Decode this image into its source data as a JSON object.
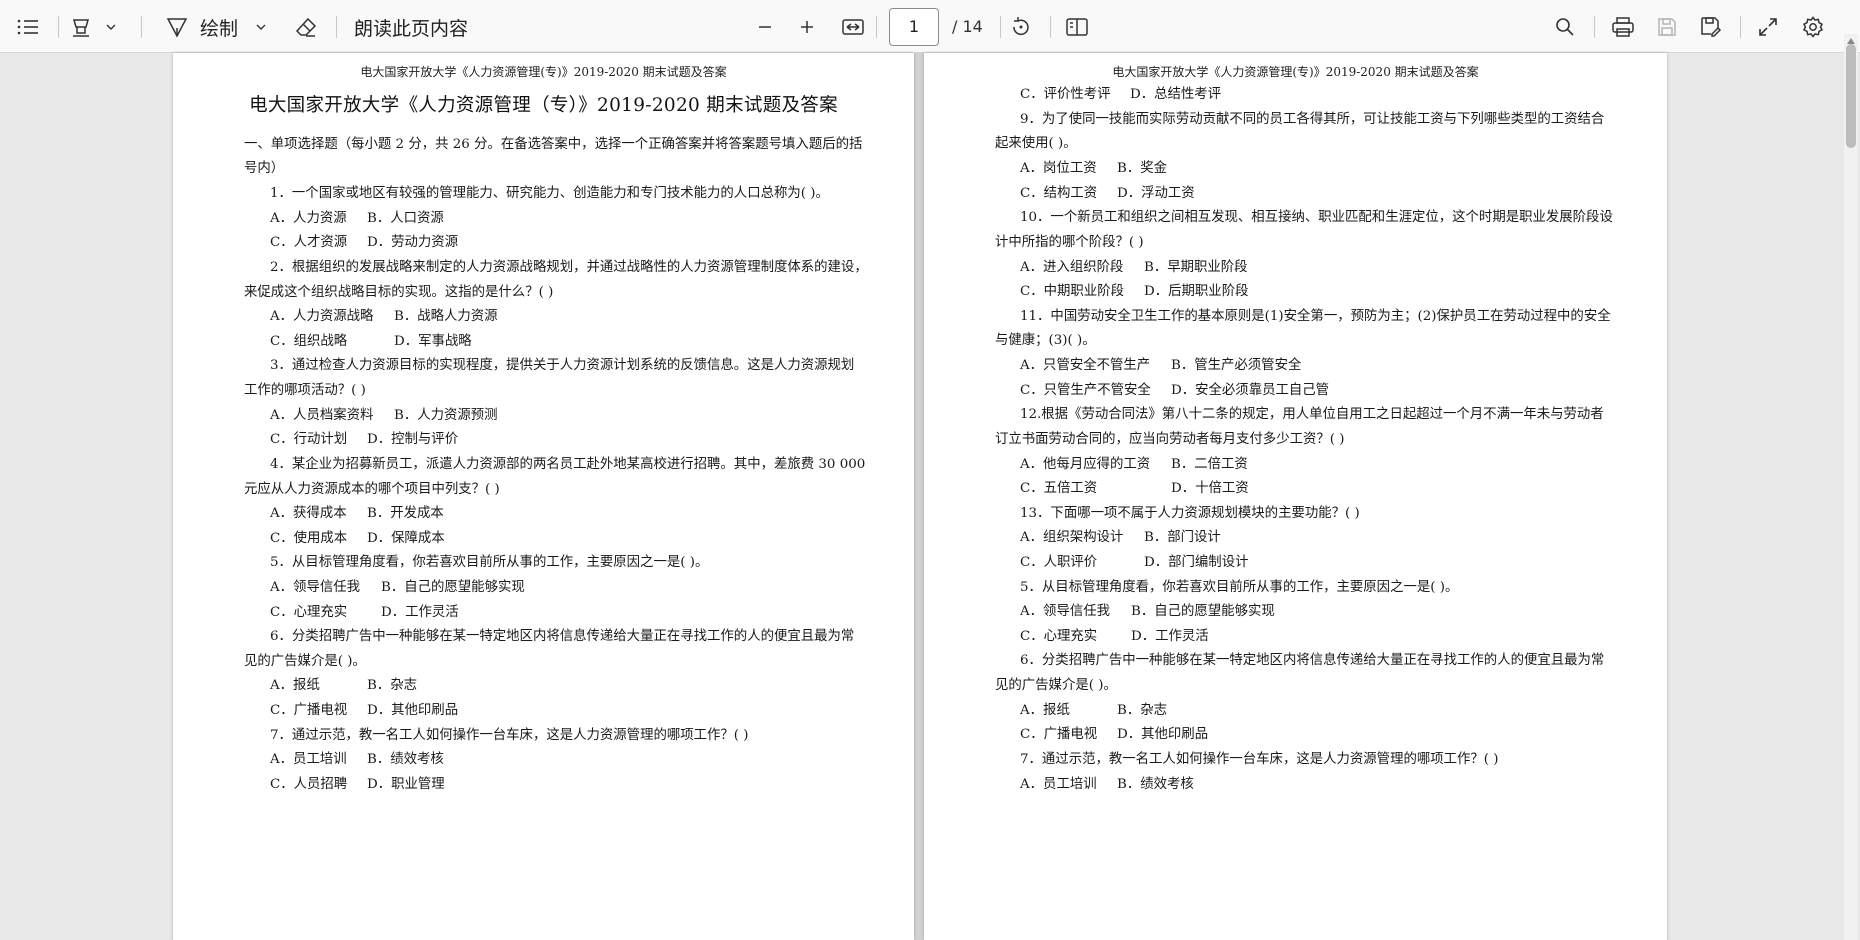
{
  "toolbar": {
    "draw_label": "绘制",
    "read_aloud_label": "朗读此页内容",
    "current_page": "1",
    "total_pages": "/ 14"
  },
  "left_page": {
    "running_header": "电大国家开放大学《人力资源管理(专)》2019-2020 期末试题及答案",
    "title": "电大国家开放大学《人力资源管理（专）》2019-2020 期末试题及答案",
    "section_heading_1": "一、单项选择题（每小题 2 分，共 26 分。在备选答案中，选择一个正确答案并将答案题号填入题后的括",
    "section_heading_2": "号内）",
    "q1": "1．一个国家或地区有较强的管理能力、研究能力、创造能力和专门技术能力的人口总称为(        )。",
    "q1_a": "A．人力资源",
    "q1_b": "B．人口资源",
    "q1_c": "C．人才资源",
    "q1_d": "D．劳动力资源",
    "q2_1": "2．根据组织的发展战略来制定的人力资源战略规划，并通过战略性的人力资源管理制度体系的建设，",
    "q2_2": "来促成这个组织战略目标的实现。这指的是什么？(        )",
    "q2_a": "A．人力资源战略",
    "q2_b": "B．战略人力资源",
    "q2_c": "C．组织战略",
    "q2_d": "D．军事战略",
    "q3_1": "3．通过检查人力资源目标的实现程度，提供关于人力资源计划系统的反馈信息。这是人力资源规划",
    "q3_2": "工作的哪项活动？(        )",
    "q3_a": "A．人员档案资料",
    "q3_b": "B．人力资源预测",
    "q3_c": "C．行动计划",
    "q3_d": "D．控制与评价",
    "q4_1": "4．某企业为招募新员工，派遣人力资源部的两名员工赴外地某高校进行招聘。其中，差旅费 30 000",
    "q4_2": "元应从人力资源成本的哪个项目中列支？(        )",
    "q4_a": "A．获得成本",
    "q4_b": "B．开发成本",
    "q4_c": "C．使用成本",
    "q4_d": "D．保障成本",
    "q5": "5．从目标管理角度看，你若喜欢目前所从事的工作，主要原因之一是(        )。",
    "q5_a": "A．领导信任我",
    "q5_b": "B．自己的愿望能够实现",
    "q5_c": "C．心理充实",
    "q5_d": "D．工作灵活",
    "q6_1": "6．分类招聘广告中一种能够在某一特定地区内将信息传递给大量正在寻找工作的人的便宜且最为常",
    "q6_2": "见的广告媒介是(        )。",
    "q6_a": "A．报纸",
    "q6_b": "B．杂志",
    "q6_c": "C．广播电视",
    "q6_d": "D．其他印刷品",
    "q7": "7．通过示范，教一名工人如何操作一台车床，这是人力资源管理的哪项工作？(        )",
    "q7_a": "A．员工培训",
    "q7_b": "B．绩效考核",
    "q7_c": "C．人员招聘",
    "q7_d": "D．职业管理"
  },
  "right_page": {
    "running_header": "电大国家开放大学《人力资源管理(专)》2019-2020 期末试题及答案",
    "q8_c": "C．评价性考评",
    "q8_d": "D．总结性考评",
    "q9_1": "9．为了使同一技能而实际劳动贡献不同的员工各得其所，可让技能工资与下列哪些类型的工资结合",
    "q9_2": "起来使用(        )。",
    "q9_a": "A．岗位工资",
    "q9_b": "B．奖金",
    "q9_c": "C．结构工资",
    "q9_d": "D．浮动工资",
    "q10_1": "10．一个新员工和组织之间相互发现、相互接纳、职业匹配和生涯定位，这个时期是职业发展阶段设",
    "q10_2": "计中所指的哪个阶段？(        )",
    "q10_a": "A．进入组织阶段",
    "q10_b": "B．早期职业阶段",
    "q10_c": "C．中期职业阶段",
    "q10_d": "D．后期职业阶段",
    "q11_1": "11．中国劳动安全卫生工作的基本原则是(1)安全第一，预防为主；(2)保护员工在劳动过程中的安全",
    "q11_2": "与健康；(3)(        )。",
    "q11_a": "A．只管安全不管生产",
    "q11_b": "B．管生产必须管安全",
    "q11_c": "C．只管生产不管安全",
    "q11_d": "D．安全必须靠员工自己管",
    "q12_1": "12.根据《劳动合同法》第八十二条的规定，用人单位自用工之日起超过一个月不满一年未与劳动者",
    "q12_2": "订立书面劳动合同的，应当向劳动者每月支付多少工资？(        )",
    "q12_a": "A．他每月应得的工资",
    "q12_b": "B．二倍工资",
    "q12_c": "C．五倍工资",
    "q12_d": "D．十倍工资",
    "q13": "13．下面哪一项不属于人力资源规划模块的主要功能？(        )",
    "q13_a": "A．组织架构设计",
    "q13_b": "B．部门设计",
    "q13_c": "C．人职评价",
    "q13_d": "D．部门编制设计",
    "q5": "5．从目标管理角度看，你若喜欢目前所从事的工作，主要原因之一是(        )。",
    "q5_a": "A．领导信任我",
    "q5_b": "B．自己的愿望能够实现",
    "q5_c": "C．心理充实",
    "q5_d": "D．工作灵活",
    "q6_1": "6．分类招聘广告中一种能够在某一特定地区内将信息传递给大量正在寻找工作的人的便宜且最为常",
    "q6_2": "见的广告媒介是(        )。",
    "q6_a": "A．报纸",
    "q6_b": "B．杂志",
    "q6_c": "C．广播电视",
    "q6_d": "D．其他印刷品",
    "q7": "7．通过示范，教一名工人如何操作一台车床，这是人力资源管理的哪项工作？(        )",
    "q7_a": "A．员工培训",
    "q7_b": "B．绩效考核"
  }
}
